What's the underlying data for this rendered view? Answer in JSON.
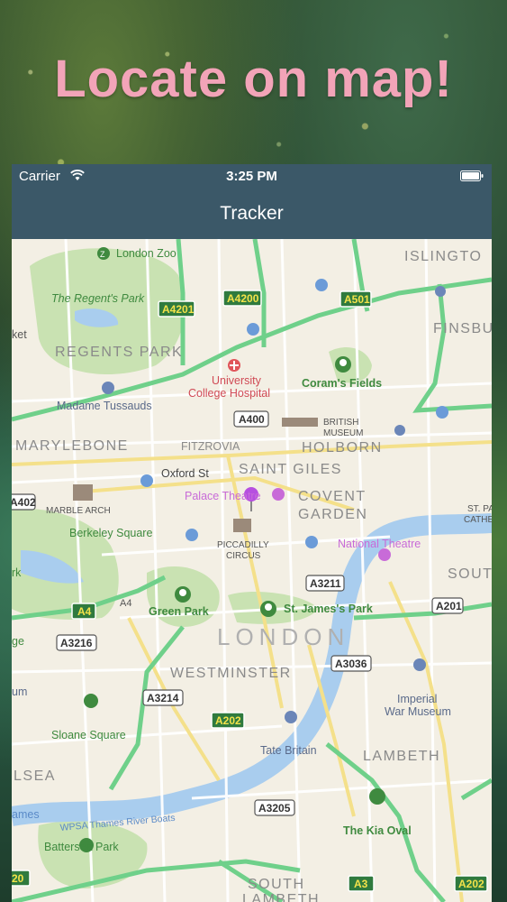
{
  "headline": "Locate on map!",
  "status_bar": {
    "carrier": "Carrier",
    "time": "3:25 PM"
  },
  "nav": {
    "title": "Tracker"
  },
  "map": {
    "district_labels": {
      "islington": "ISLINGTO",
      "regents_park": "REGENTS PARK",
      "finsbury": "FINSBU",
      "marylebone": "MARYLEBONE",
      "fitzrovia": "FITZROVIA",
      "holborn": "HOLBORN",
      "saint_giles": "SAINT GILES",
      "covent_garden_1": "COVENT",
      "covent_garden_2": "GARDEN",
      "south": "SOUT",
      "london": "LONDON",
      "westminster": "WESTMINSTER",
      "lambeth": "LAMBETH",
      "chelsea": "LSEA",
      "south_lambeth_1": "SOUTH",
      "south_lambeth_2": "LAMBETH"
    },
    "poi_labels": {
      "london_zoo": "London Zoo",
      "regents_park": "The Regent's Park",
      "university_hospital_1": "University",
      "university_hospital_2": "College Hospital",
      "corams_fields": "Coram's Fields",
      "madame_tussauds": "Madame Tussauds",
      "british_museum_1": "BRITISH",
      "british_museum_2": "MUSEUM",
      "oxford_st": "Oxford St",
      "palace_theatre": "Palace Theatre",
      "marble_arch": "MARBLE ARCH",
      "berkeley_square": "Berkeley Square",
      "piccadilly_1": "PICCADILLY",
      "piccadilly_2": "CIRCUS",
      "national_theatre": "National Theatre",
      "st_pauls_1": "ST. PA",
      "st_pauls_2": "CATHE",
      "green_park": "Green Park",
      "st_james_park": "St. James's Park",
      "imperial_war_museum_1": "Imperial",
      "imperial_war_museum_2": "War Museum",
      "sloane_square": "Sloane Square",
      "tate_britain": "Tate Britain",
      "wpsa": "WPSA Thames River Boats",
      "kia_oval": "The Kia Oval",
      "battersea_park": "Battersea Park",
      "ket": "ket",
      "rk": "rk",
      "ge": "ge",
      "um": "um",
      "ames": "ames",
      "a4_small": "A4"
    },
    "road_shields": {
      "a4201": "A4201",
      "a4200": "A4200",
      "a501": "A501",
      "a4": "A4",
      "a202_mid": "A202",
      "a3": "A3",
      "a202_right": "A202",
      "a20_left": "20"
    },
    "road_numbers": {
      "a400": "A400",
      "a402": "A402",
      "a3211": "A3211",
      "a201": "A201",
      "a3216": "A3216",
      "a3036": "A3036",
      "a3214": "A3214",
      "a3205": "A3205"
    },
    "pin_color": "#b64fe0"
  }
}
